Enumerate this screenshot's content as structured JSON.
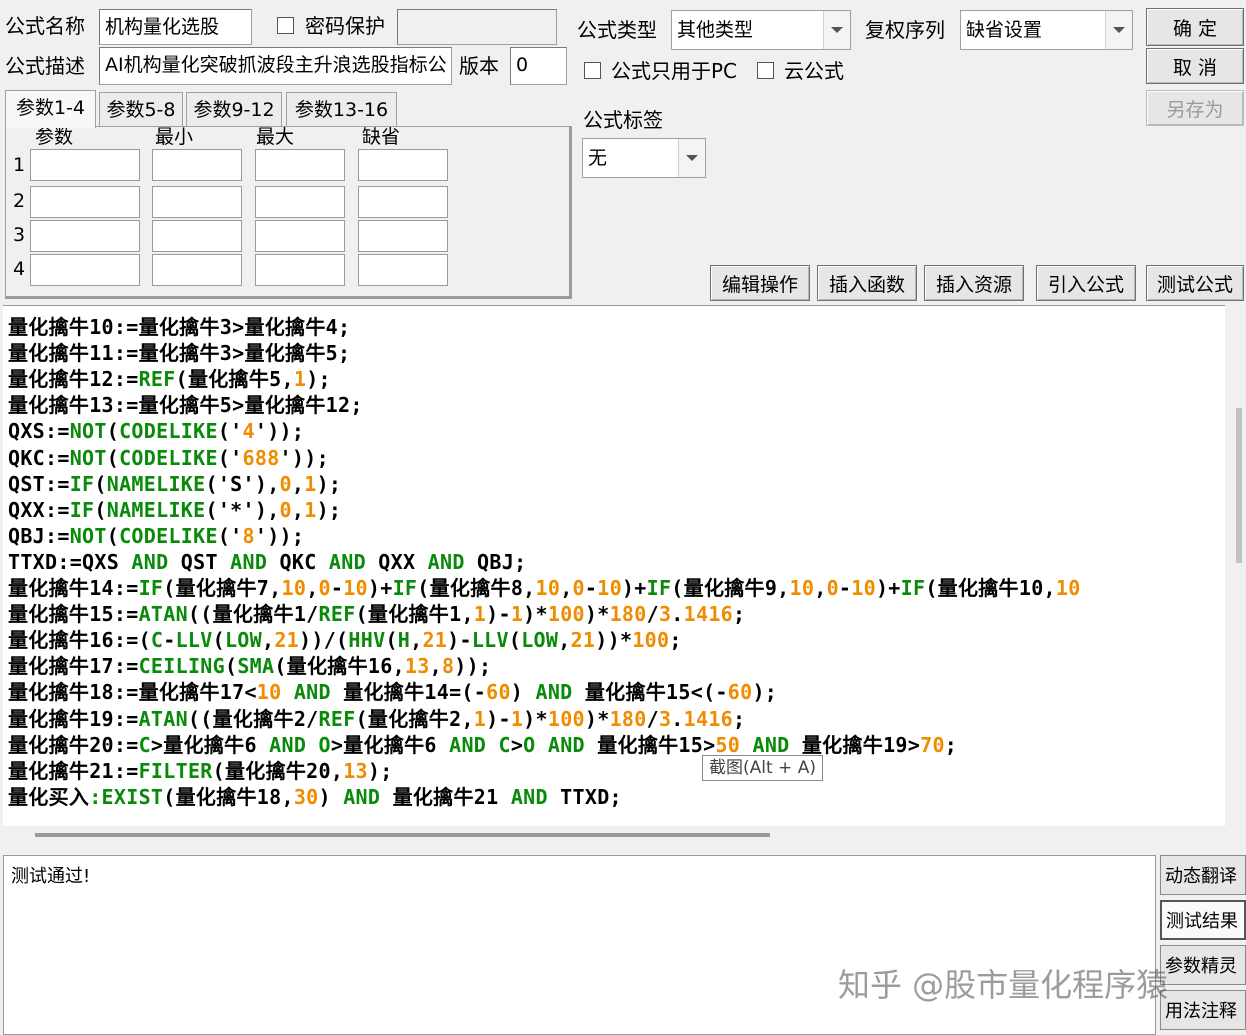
{
  "header": {
    "formula_name_label": "公式名称",
    "formula_name_value": "机构量化选股",
    "password_label": "密码保护",
    "formula_desc_label": "公式描述",
    "formula_desc_value": "AI机构量化突破抓波段主升浪选股指标公",
    "version_label": "版本",
    "version_value": "0",
    "formula_type_label": "公式类型",
    "formula_type_value": "其他类型",
    "fuquan_label": "复权序列",
    "fuquan_value": "缺省设置",
    "pc_only_label": "公式只用于PC",
    "cloud_label": "云公式",
    "tag_label": "公式标签",
    "tag_value": "无"
  },
  "buttons": {
    "confirm": "确 定",
    "cancel": "取 消",
    "save_as": "另存为",
    "edit_ops": "编辑操作",
    "insert_func": "插入函数",
    "insert_res": "插入资源",
    "import_formula": "引入公式",
    "test_formula": "测试公式"
  },
  "params": {
    "tabs": [
      "参数1-4",
      "参数5-8",
      "参数9-12",
      "参数13-16"
    ],
    "headers": [
      "参数",
      "最小",
      "最大",
      "缺省"
    ],
    "rows": [
      "1",
      "2",
      "3",
      "4"
    ]
  },
  "code": [
    [
      [
        "t",
        "量化擒牛10:=量化擒牛3>量化擒牛4;"
      ]
    ],
    [
      [
        "t",
        "量化擒牛11:=量化擒牛3>量化擒牛5;"
      ]
    ],
    [
      [
        "t",
        "量化擒牛12:="
      ],
      [
        "k",
        "REF"
      ],
      [
        "t",
        "(量化擒牛5,"
      ],
      [
        "n",
        "1"
      ],
      [
        "t",
        ");"
      ]
    ],
    [
      [
        "t",
        "量化擒牛13:=量化擒牛5>量化擒牛12;"
      ]
    ],
    [
      [
        "t",
        "QXS:="
      ],
      [
        "k",
        "NOT"
      ],
      [
        "t",
        "("
      ],
      [
        "k",
        "CODELIKE"
      ],
      [
        "t",
        "('"
      ],
      [
        "n",
        "4"
      ],
      [
        "t",
        "'));"
      ]
    ],
    [
      [
        "t",
        "QKC:="
      ],
      [
        "k",
        "NOT"
      ],
      [
        "t",
        "("
      ],
      [
        "k",
        "CODELIKE"
      ],
      [
        "t",
        "('"
      ],
      [
        "n",
        "688"
      ],
      [
        "t",
        "'));"
      ]
    ],
    [
      [
        "t",
        "QST:="
      ],
      [
        "k",
        "IF"
      ],
      [
        "t",
        "("
      ],
      [
        "k",
        "NAMELIKE"
      ],
      [
        "t",
        "('S'),"
      ],
      [
        "n",
        "0"
      ],
      [
        "t",
        ","
      ],
      [
        "n",
        "1"
      ],
      [
        "t",
        ");"
      ]
    ],
    [
      [
        "t",
        "QXX:="
      ],
      [
        "k",
        "IF"
      ],
      [
        "t",
        "("
      ],
      [
        "k",
        "NAMELIKE"
      ],
      [
        "t",
        "('*'),"
      ],
      [
        "n",
        "0"
      ],
      [
        "t",
        ","
      ],
      [
        "n",
        "1"
      ],
      [
        "t",
        ");"
      ]
    ],
    [
      [
        "t",
        "QBJ:="
      ],
      [
        "k",
        "NOT"
      ],
      [
        "t",
        "("
      ],
      [
        "k",
        "CODELIKE"
      ],
      [
        "t",
        "('"
      ],
      [
        "n",
        "8"
      ],
      [
        "t",
        "'));"
      ]
    ],
    [
      [
        "t",
        "TTXD:=QXS "
      ],
      [
        "k",
        "AND"
      ],
      [
        "t",
        " QST "
      ],
      [
        "k",
        "AND"
      ],
      [
        "t",
        " QKC "
      ],
      [
        "k",
        "AND"
      ],
      [
        "t",
        " QXX "
      ],
      [
        "k",
        "AND"
      ],
      [
        "t",
        " QBJ;"
      ]
    ],
    [
      [
        "t",
        "量化擒牛14:="
      ],
      [
        "k",
        "IF"
      ],
      [
        "t",
        "(量化擒牛7,"
      ],
      [
        "n",
        "10"
      ],
      [
        "t",
        ","
      ],
      [
        "n",
        "0"
      ],
      [
        "t",
        "-"
      ],
      [
        "n",
        "10"
      ],
      [
        "t",
        ")+"
      ],
      [
        "k",
        "IF"
      ],
      [
        "t",
        "(量化擒牛8,"
      ],
      [
        "n",
        "10"
      ],
      [
        "t",
        ","
      ],
      [
        "n",
        "0"
      ],
      [
        "t",
        "-"
      ],
      [
        "n",
        "10"
      ],
      [
        "t",
        ")+"
      ],
      [
        "k",
        "IF"
      ],
      [
        "t",
        "(量化擒牛9,"
      ],
      [
        "n",
        "10"
      ],
      [
        "t",
        ","
      ],
      [
        "n",
        "0"
      ],
      [
        "t",
        "-"
      ],
      [
        "n",
        "10"
      ],
      [
        "t",
        ")+"
      ],
      [
        "k",
        "IF"
      ],
      [
        "t",
        "(量化擒牛10,"
      ],
      [
        "n",
        "10"
      ]
    ],
    [
      [
        "t",
        "量化擒牛15:="
      ],
      [
        "k",
        "ATAN"
      ],
      [
        "t",
        "((量化擒牛1/"
      ],
      [
        "k",
        "REF"
      ],
      [
        "t",
        "(量化擒牛1,"
      ],
      [
        "n",
        "1"
      ],
      [
        "t",
        ")-"
      ],
      [
        "n",
        "1"
      ],
      [
        "t",
        ")*"
      ],
      [
        "n",
        "100"
      ],
      [
        "t",
        ")*"
      ],
      [
        "n",
        "180"
      ],
      [
        "t",
        "/"
      ],
      [
        "n",
        "3"
      ],
      [
        "t",
        "."
      ],
      [
        "n",
        "1416"
      ],
      [
        "t",
        ";"
      ]
    ],
    [
      [
        "t",
        "量化擒牛16:=("
      ],
      [
        "k",
        "C"
      ],
      [
        "t",
        "-"
      ],
      [
        "k",
        "LLV"
      ],
      [
        "t",
        "("
      ],
      [
        "k",
        "LOW"
      ],
      [
        "t",
        ","
      ],
      [
        "n",
        "21"
      ],
      [
        "t",
        "))/("
      ],
      [
        "k",
        "HHV"
      ],
      [
        "t",
        "("
      ],
      [
        "k",
        "H"
      ],
      [
        "t",
        ","
      ],
      [
        "n",
        "21"
      ],
      [
        "t",
        ")-"
      ],
      [
        "k",
        "LLV"
      ],
      [
        "t",
        "("
      ],
      [
        "k",
        "LOW"
      ],
      [
        "t",
        ","
      ],
      [
        "n",
        "21"
      ],
      [
        "t",
        "))*"
      ],
      [
        "n",
        "100"
      ],
      [
        "t",
        ";"
      ]
    ],
    [
      [
        "t",
        "量化擒牛17:="
      ],
      [
        "k",
        "CEILING"
      ],
      [
        "t",
        "("
      ],
      [
        "k",
        "SMA"
      ],
      [
        "t",
        "(量化擒牛16,"
      ],
      [
        "n",
        "13"
      ],
      [
        "t",
        ","
      ],
      [
        "n",
        "8"
      ],
      [
        "t",
        "));"
      ]
    ],
    [
      [
        "t",
        "量化擒牛18:=量化擒牛17<"
      ],
      [
        "n",
        "10"
      ],
      [
        "t",
        " "
      ],
      [
        "k",
        "AND"
      ],
      [
        "t",
        " 量化擒牛14=(-"
      ],
      [
        "n",
        "60"
      ],
      [
        "t",
        ") "
      ],
      [
        "k",
        "AND"
      ],
      [
        "t",
        " 量化擒牛15<(-"
      ],
      [
        "n",
        "60"
      ],
      [
        "t",
        ");"
      ]
    ],
    [
      [
        "t",
        "量化擒牛19:="
      ],
      [
        "k",
        "ATAN"
      ],
      [
        "t",
        "((量化擒牛2/"
      ],
      [
        "k",
        "REF"
      ],
      [
        "t",
        "(量化擒牛2,"
      ],
      [
        "n",
        "1"
      ],
      [
        "t",
        ")-"
      ],
      [
        "n",
        "1"
      ],
      [
        "t",
        ")*"
      ],
      [
        "n",
        "100"
      ],
      [
        "t",
        ")*"
      ],
      [
        "n",
        "180"
      ],
      [
        "t",
        "/"
      ],
      [
        "n",
        "3"
      ],
      [
        "t",
        "."
      ],
      [
        "n",
        "1416"
      ],
      [
        "t",
        ";"
      ]
    ],
    [
      [
        "t",
        "量化擒牛20:="
      ],
      [
        "k",
        "C"
      ],
      [
        "t",
        ">量化擒牛6 "
      ],
      [
        "k",
        "AND"
      ],
      [
        "t",
        " "
      ],
      [
        "k",
        "O"
      ],
      [
        "t",
        ">量化擒牛6 "
      ],
      [
        "k",
        "AND"
      ],
      [
        "t",
        " "
      ],
      [
        "k",
        "C"
      ],
      [
        "t",
        ">"
      ],
      [
        "k",
        "O"
      ],
      [
        "t",
        " "
      ],
      [
        "k",
        "AND"
      ],
      [
        "t",
        " 量化擒牛15>"
      ],
      [
        "n",
        "50"
      ],
      [
        "t",
        " "
      ],
      [
        "k",
        "AND"
      ],
      [
        "t",
        " 量化擒牛19>"
      ],
      [
        "n",
        "70"
      ],
      [
        "t",
        ";"
      ]
    ],
    [
      [
        "t",
        "量化擒牛21:="
      ],
      [
        "k",
        "FILTER"
      ],
      [
        "t",
        "(量化擒牛20,"
      ],
      [
        "n",
        "13"
      ],
      [
        "t",
        ");"
      ]
    ],
    [
      [
        "t",
        "量化买入"
      ],
      [
        "k",
        ":EXIST"
      ],
      [
        "t",
        "(量化擒牛18,"
      ],
      [
        "n",
        "30"
      ],
      [
        "t",
        ") "
      ],
      [
        "k",
        "AND"
      ],
      [
        "t",
        " 量化擒牛21 "
      ],
      [
        "k",
        "AND"
      ],
      [
        "t",
        " TTXD;"
      ]
    ]
  ],
  "tooltip": "截图(Alt + A)",
  "result_message": "测试通过!",
  "side_buttons": [
    "动态翻译",
    "测试结果",
    "参数精灵",
    "用法注释"
  ],
  "watermark": "知乎 @股市量化程序猿",
  "colors": {
    "keyword": "#0a8a0a",
    "number": "#f08c00",
    "text": "#000000"
  }
}
